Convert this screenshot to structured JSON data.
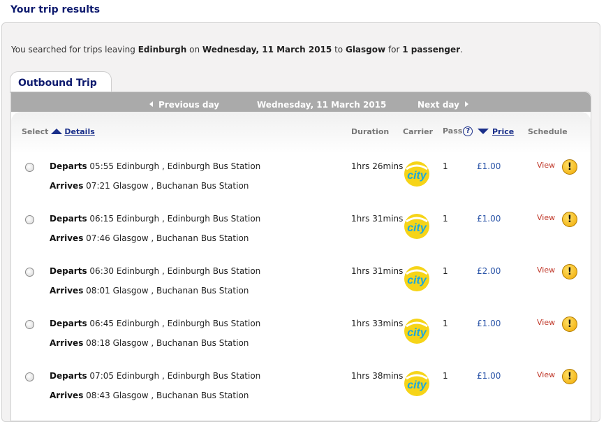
{
  "page": {
    "title": "Your trip results"
  },
  "summary": {
    "prefix": "You searched for trips leaving ",
    "origin": "Edinburgh",
    "on": " on ",
    "date": "Wednesday, 11 March 2015",
    "to": " to ",
    "destination": "Glasgow",
    "for": " for ",
    "passengers": "1 passenger",
    "end": "."
  },
  "tab": {
    "label": "Outbound Trip"
  },
  "daybar": {
    "prev": "Previous day",
    "current": "Wednesday, 11 March 2015",
    "next": "Next day"
  },
  "columns": {
    "select": "Select",
    "details": "Details",
    "duration": "Duration",
    "carrier": "Carrier",
    "pass": "Pass",
    "help": "?",
    "price": "Price",
    "schedule": "Schedule"
  },
  "labels": {
    "departs": "Departs",
    "arrives": "Arrives",
    "view": "View",
    "warn": "!"
  },
  "carrier_logo": {
    "text": "city",
    "colors": {
      "circle": "#f6d418",
      "text": "#1aa7e0"
    }
  },
  "trips": [
    {
      "dep_time": "05:55",
      "dep_place": "Edinburgh , Edinburgh Bus Station",
      "arr_time": "07:21",
      "arr_place": "Glasgow , Buchanan Bus Station",
      "duration": "1hrs 26mins",
      "pass": "1",
      "price": "£1.00"
    },
    {
      "dep_time": "06:15",
      "dep_place": "Edinburgh , Edinburgh Bus Station",
      "arr_time": "07:46",
      "arr_place": "Glasgow , Buchanan Bus Station",
      "duration": "1hrs 31mins",
      "pass": "1",
      "price": "£1.00"
    },
    {
      "dep_time": "06:30",
      "dep_place": "Edinburgh , Edinburgh Bus Station",
      "arr_time": "08:01",
      "arr_place": "Glasgow , Buchanan Bus Station",
      "duration": "1hrs 31mins",
      "pass": "1",
      "price": "£2.00"
    },
    {
      "dep_time": "06:45",
      "dep_place": "Edinburgh , Edinburgh Bus Station",
      "arr_time": "08:18",
      "arr_place": "Glasgow , Buchanan Bus Station",
      "duration": "1hrs 33mins",
      "pass": "1",
      "price": "£1.00"
    },
    {
      "dep_time": "07:05",
      "dep_place": "Edinburgh , Edinburgh Bus Station",
      "arr_time": "08:43",
      "arr_place": "Glasgow , Buchanan Bus Station",
      "duration": "1hrs 38mins",
      "pass": "1",
      "price": "£1.00"
    }
  ]
}
